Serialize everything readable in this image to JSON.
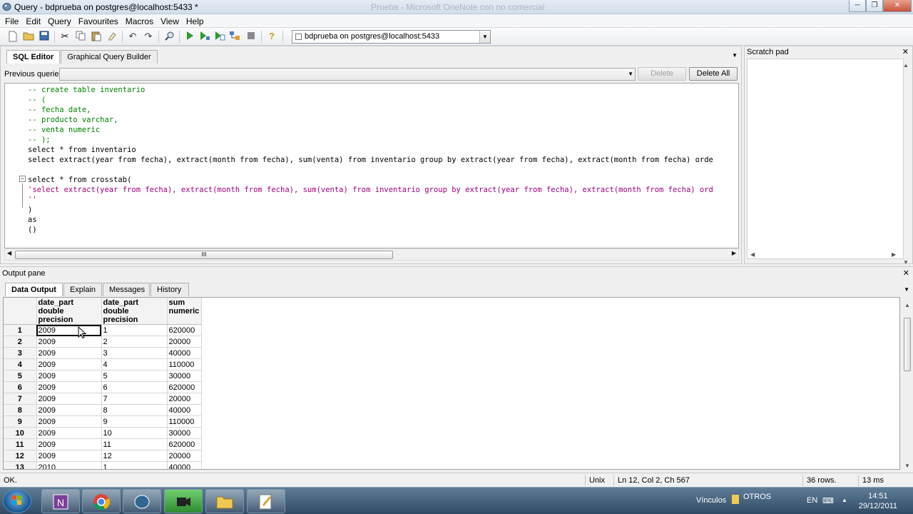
{
  "window": {
    "title": "Query - bdprueba on postgres@localhost:5433 *",
    "ghost_title": "Prueba - Microsoft OneNote con no comercial",
    "minimize": "─",
    "restore": "❐",
    "close": "✕"
  },
  "menu": [
    "File",
    "Edit",
    "Query",
    "Favourites",
    "Macros",
    "View",
    "Help"
  ],
  "toolbar": {
    "connection": "bdprueba on postgres@localhost:5433"
  },
  "editor": {
    "tabs": [
      "SQL Editor",
      "Graphical Query Builder"
    ],
    "previous_queries_label": "Previous queries",
    "delete_label": "Delete",
    "delete_all_label": "Delete All",
    "code_lines": [
      "-- create table inventario",
      "-- (",
      "-- fecha date,",
      "-- producto varchar,",
      "-- venta numeric",
      "-- );",
      "select * from inventario",
      "select extract(year from fecha), extract(month from fecha), sum(venta) from inventario group by extract(year from fecha), extract(month from fecha) orde",
      "",
      "select * from crosstab(",
      "'select extract(year from fecha), extract(month from fecha), sum(venta) from inventario group by extract(year from fecha), extract(month from fecha) ord",
      "''",
      ")",
      "as",
      "()"
    ]
  },
  "scratch_pad": {
    "title": "Scratch pad"
  },
  "output": {
    "title": "Output pane",
    "tabs": [
      "Data Output",
      "Explain",
      "Messages",
      "History"
    ],
    "columns": [
      {
        "name": "date_part",
        "type": "double precision"
      },
      {
        "name": "date_part",
        "type": "double precision"
      },
      {
        "name": "sum",
        "type": "numeric"
      }
    ],
    "rows": [
      [
        "1",
        "2009",
        "1",
        "620000"
      ],
      [
        "2",
        "2009",
        "2",
        "20000"
      ],
      [
        "3",
        "2009",
        "3",
        "40000"
      ],
      [
        "4",
        "2009",
        "4",
        "110000"
      ],
      [
        "5",
        "2009",
        "5",
        "30000"
      ],
      [
        "6",
        "2009",
        "6",
        "620000"
      ],
      [
        "7",
        "2009",
        "7",
        "20000"
      ],
      [
        "8",
        "2009",
        "8",
        "40000"
      ],
      [
        "9",
        "2009",
        "9",
        "110000"
      ],
      [
        "10",
        "2009",
        "10",
        "30000"
      ],
      [
        "11",
        "2009",
        "11",
        "620000"
      ],
      [
        "12",
        "2009",
        "12",
        "20000"
      ],
      [
        "13",
        "2010",
        "1",
        "40000"
      ]
    ]
  },
  "statusbar": {
    "status": "OK.",
    "line_endings": "Unix",
    "position": "Ln 12, Col 2, Ch 567",
    "rows": "36 rows.",
    "time": "13 ms"
  },
  "taskbar": {
    "vinculos": "Vínculos",
    "otros": "OTROS",
    "lang": "EN",
    "time": "14:51",
    "date": "29/12/2011"
  },
  "icons": {
    "new": "new-file-icon",
    "open": "open-icon",
    "save": "save-icon",
    "cut": "cut-icon",
    "copy": "copy-icon",
    "paste": "paste-icon",
    "clear": "clear-icon",
    "undo": "undo-icon",
    "redo": "redo-icon",
    "find": "find-icon",
    "execute": "execute-icon",
    "help": "help-icon"
  }
}
